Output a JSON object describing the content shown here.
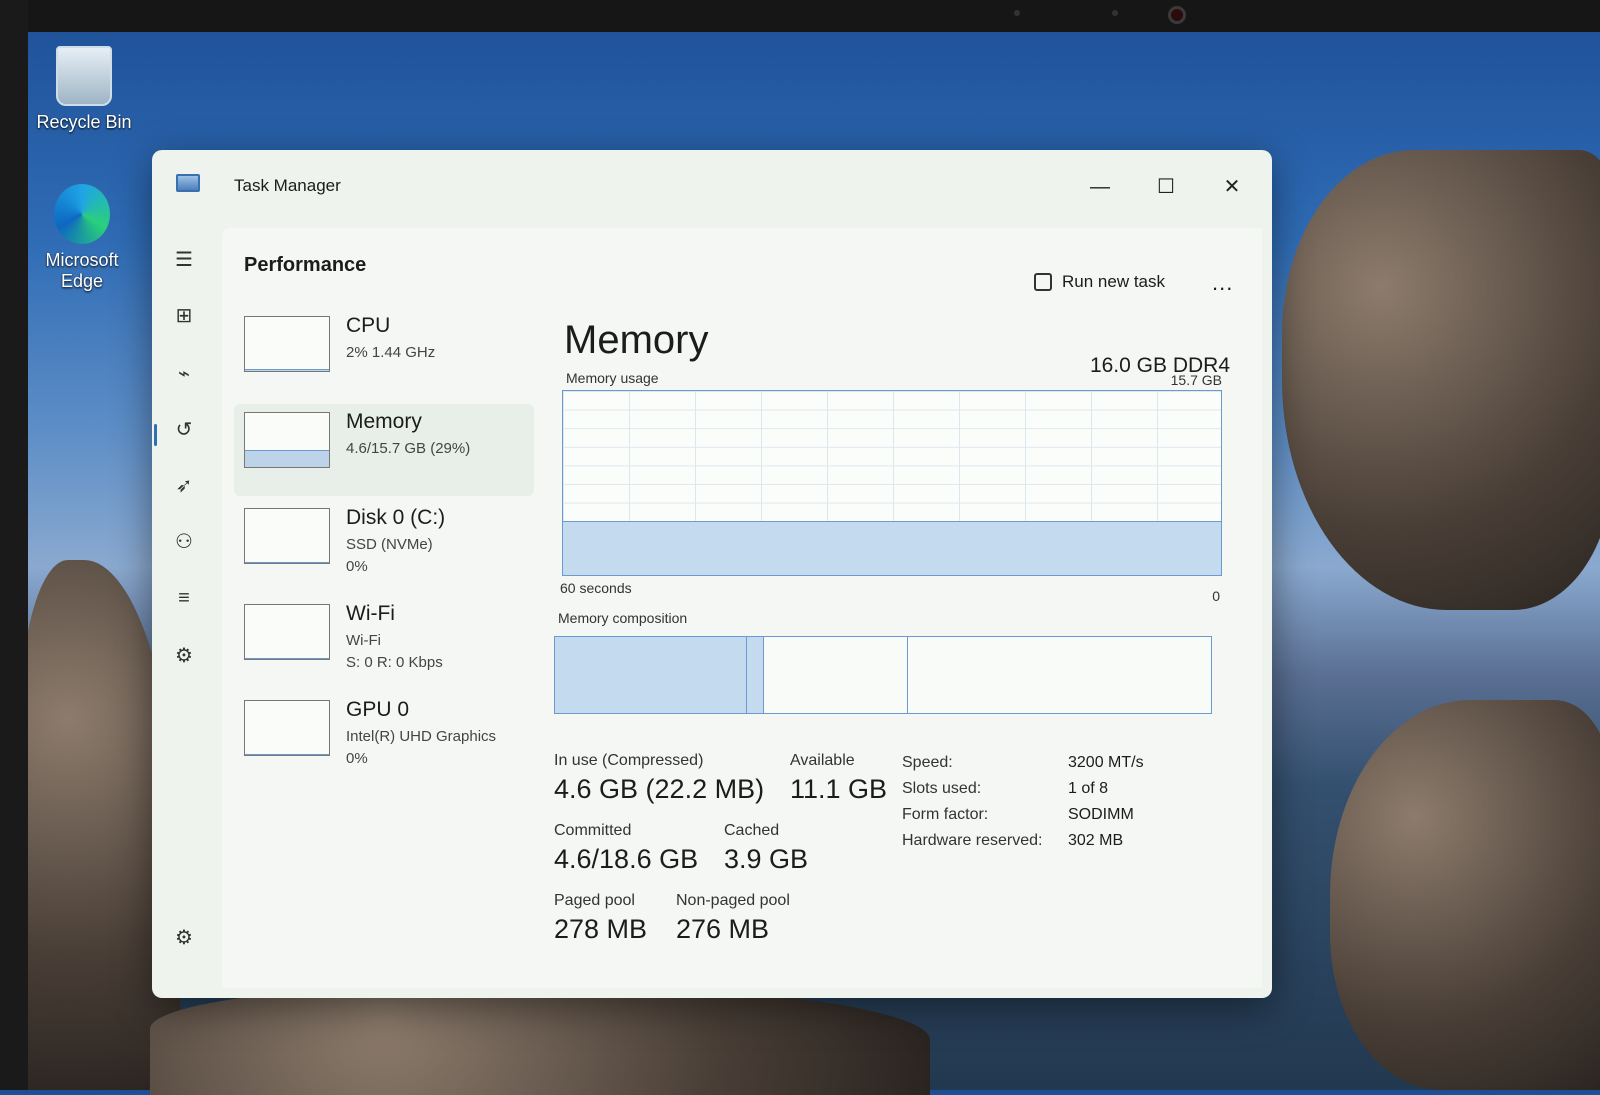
{
  "desktop": {
    "icons": [
      {
        "label": "Recycle Bin"
      },
      {
        "label": "Microsoft Edge"
      }
    ]
  },
  "window": {
    "title": "Task Manager",
    "minimize_glyph": "—",
    "maximize_glyph": "☐",
    "close_glyph": "✕"
  },
  "rail": {
    "items": [
      {
        "icon": "hamburger-icon",
        "glyph": "☰"
      },
      {
        "icon": "processes-icon",
        "glyph": "⊞"
      },
      {
        "icon": "performance-icon",
        "glyph": "⌁"
      },
      {
        "icon": "app-history-icon",
        "glyph": "↺"
      },
      {
        "icon": "startup-apps-icon",
        "glyph": "➶"
      },
      {
        "icon": "users-icon",
        "glyph": "⚇"
      },
      {
        "icon": "details-icon",
        "glyph": "≡"
      },
      {
        "icon": "services-icon",
        "glyph": "⚙"
      }
    ],
    "settings_glyph": "⚙"
  },
  "header": {
    "title": "Performance",
    "run_new_task": "Run new task",
    "more": "..."
  },
  "perf_list": [
    {
      "name": "CPU",
      "sub": [
        "2%  1.44 GHz"
      ],
      "fill": 0.02
    },
    {
      "name": "Memory",
      "sub": [
        "4.6/15.7 GB (29%)"
      ],
      "fill": 0.29
    },
    {
      "name": "Disk 0 (C:)",
      "sub": [
        "SSD (NVMe)",
        "0%"
      ],
      "fill": 0.0
    },
    {
      "name": "Wi-Fi",
      "sub": [
        "Wi-Fi",
        "S: 0  R: 0 Kbps"
      ],
      "fill": 0.0
    },
    {
      "name": "GPU 0",
      "sub": [
        "Intel(R) UHD Graphics",
        "0%"
      ],
      "fill": 0.0
    }
  ],
  "memory": {
    "title": "Memory",
    "spec": "16.0 GB DDR4",
    "usage_label": "Memory usage",
    "max_label": "15.7 GB",
    "time_label": "60 seconds",
    "zero_label": "0",
    "usage_fraction": 0.29,
    "composition_label": "Memory composition",
    "composition": {
      "in_use_fraction": 0.293,
      "modified_fraction": 0.025,
      "standby_fraction": 0.22
    },
    "stats": {
      "in_use_label": "In use (Compressed)",
      "in_use_value": "4.6 GB (22.2 MB)",
      "available_label": "Available",
      "available_value": "11.1 GB",
      "committed_label": "Committed",
      "committed_value": "4.6/18.6 GB",
      "cached_label": "Cached",
      "cached_value": "3.9 GB",
      "paged_label": "Paged pool",
      "paged_value": "278 MB",
      "nonpaged_label": "Non-paged pool",
      "nonpaged_value": "276 MB"
    },
    "details": [
      {
        "key": "Speed:",
        "value": "3200 MT/s"
      },
      {
        "key": "Slots used:",
        "value": "1 of 8"
      },
      {
        "key": "Form factor:",
        "value": "SODIMM"
      },
      {
        "key": "Hardware reserved:",
        "value": "302 MB"
      }
    ]
  }
}
